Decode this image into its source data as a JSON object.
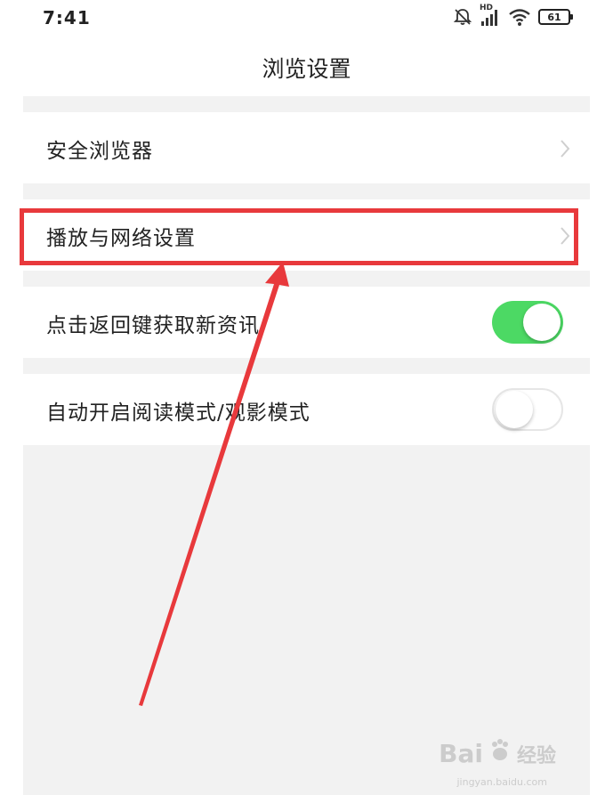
{
  "status_bar": {
    "time": "7:41",
    "network_label": "HD",
    "battery": "61",
    "icons": [
      "bell-muted-icon",
      "signal-icon",
      "wifi-icon",
      "battery-icon"
    ]
  },
  "header": {
    "title": "浏览设置"
  },
  "settings": {
    "items": [
      {
        "label": "安全浏览器",
        "type": "link"
      },
      {
        "label": "播放与网络设置",
        "type": "link"
      },
      {
        "label": "点击返回键获取新资讯",
        "type": "toggle",
        "on": true
      },
      {
        "label": "自动开启阅读模式/观影模式",
        "type": "toggle",
        "on": false
      }
    ]
  },
  "colors": {
    "toggle_on": "#4cd964",
    "highlight": "#e8393c",
    "background": "#f2f2f2"
  },
  "watermark": {
    "brand": "Bai",
    "brand_suffix": "经验",
    "url": "jingyan.baidu.com"
  }
}
